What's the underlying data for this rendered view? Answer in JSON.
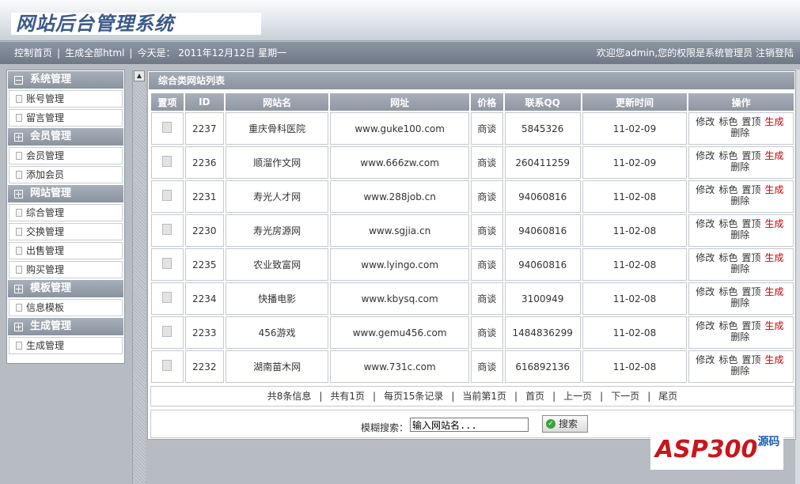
{
  "header": {
    "logo_text": "网站后台管理系统"
  },
  "topnav": {
    "items": [
      "控制首页",
      "|",
      "生成全部html",
      "|",
      "今天是： 2011年12月12日 星期一"
    ],
    "right_text": "欢迎您admin,您的权限是系统管理员 注销登陆"
  },
  "sidebar": {
    "sections": [
      {
        "title": "系统管理",
        "expanded": true,
        "items": [
          "账号管理",
          "留言管理"
        ]
      },
      {
        "title": "会员管理",
        "expanded": false,
        "items": [
          "会员管理",
          "添加会员"
        ]
      },
      {
        "title": "网站管理",
        "expanded": false,
        "items": [
          "综合管理",
          "交换管理",
          "出售管理",
          "购买管理"
        ]
      },
      {
        "title": "模板管理",
        "expanded": false,
        "items": [
          "信息模板"
        ]
      },
      {
        "title": "生成管理",
        "expanded": false,
        "items": [
          "生成管理"
        ]
      }
    ]
  },
  "main": {
    "title": "综合类网站列表",
    "columns": [
      "置项",
      "ID",
      "网站名",
      "网址",
      "价格",
      "联系QQ",
      "更新时间",
      "操作"
    ],
    "rows": [
      {
        "id": "2237",
        "name": "重庆骨科医院",
        "url": "www.guke100.com",
        "price": "商谈",
        "qq": "5845326",
        "time": "11-02-09"
      },
      {
        "id": "2236",
        "name": "顺溜作文网",
        "url": "www.666zw.com",
        "price": "商谈",
        "qq": "260411259",
        "time": "11-02-09"
      },
      {
        "id": "2231",
        "name": "寿光人才网",
        "url": "www.288job.cn",
        "price": "商谈",
        "qq": "94060816",
        "time": "11-02-08"
      },
      {
        "id": "2230",
        "name": "寿光房源网",
        "url": "www.sgjia.cn",
        "price": "商谈",
        "qq": "94060816",
        "time": "11-02-08"
      },
      {
        "id": "2235",
        "name": "农业致富网",
        "url": "www.lyingo.com",
        "price": "商谈",
        "qq": "94060816",
        "time": "11-02-08"
      },
      {
        "id": "2234",
        "name": "快播电影",
        "url": "www.kbysq.com",
        "price": "商谈",
        "qq": "3100949",
        "time": "11-02-08"
      },
      {
        "id": "2233",
        "name": "456游戏",
        "url": "www.gemu456.com",
        "price": "商谈",
        "qq": "1484836299",
        "time": "11-02-08"
      },
      {
        "id": "2232",
        "name": "湖南苗木网",
        "url": "www.731c.com",
        "price": "商谈",
        "qq": "616892136",
        "time": "11-02-08"
      }
    ],
    "ops": {
      "edit": "修改",
      "color": "标色",
      "top": "置顶",
      "gen": "生成",
      "del": "删除"
    },
    "pager": [
      "共8条信息",
      "|",
      "共有1页",
      "|",
      "每页15条记录",
      "|",
      "当前第1页",
      "|",
      "首页",
      "|",
      "上一页",
      "|",
      "下一页",
      "|",
      "尾页"
    ],
    "search": {
      "label": "模糊搜索：",
      "placeholder": "输入网站名...",
      "button": "搜索"
    }
  },
  "watermark": {
    "brand": "ASP300",
    "sub": "源码"
  },
  "colors": {
    "header_bar": "#7a8491",
    "section": "#8f98a3",
    "gen_link": "#cc0000"
  }
}
